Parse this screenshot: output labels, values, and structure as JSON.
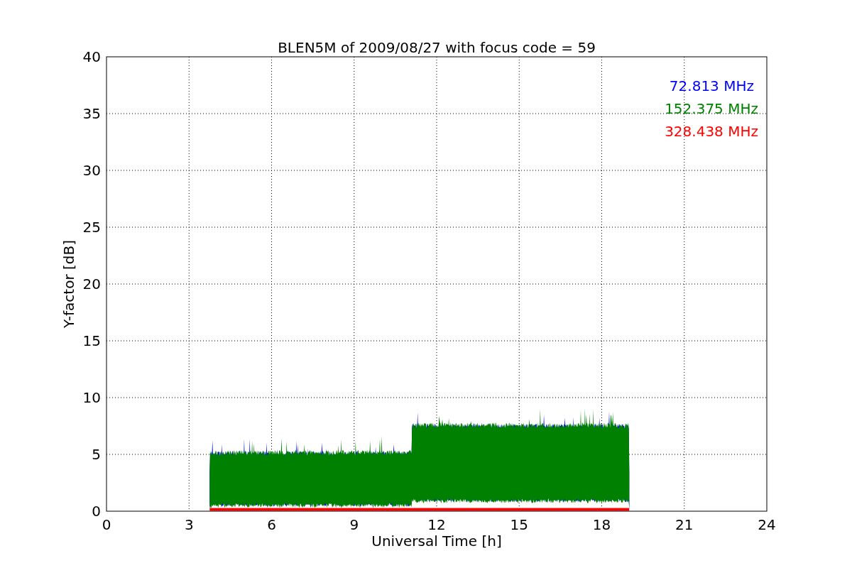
{
  "chart": {
    "title": "BLEN5M of 2009/08/27 with focus code = 59",
    "xlabel": "Universal Time [h]",
    "ylabel": "Y-factor [dB]",
    "xticks": [
      "0",
      "3",
      "6",
      "9",
      "12",
      "15",
      "18",
      "21",
      "24"
    ],
    "yticks": [
      "40",
      "35",
      "30",
      "25",
      "20",
      "15",
      "10",
      "5",
      "0"
    ],
    "series": [
      {
        "name": "72.813 MHz",
        "color": "#0000ff",
        "kind": "band"
      },
      {
        "name": "152.375 MHz",
        "color": "#008000",
        "kind": "band"
      },
      {
        "name": "328.438 MHz",
        "color": "#ff0000",
        "kind": "baseline"
      }
    ]
  }
}
